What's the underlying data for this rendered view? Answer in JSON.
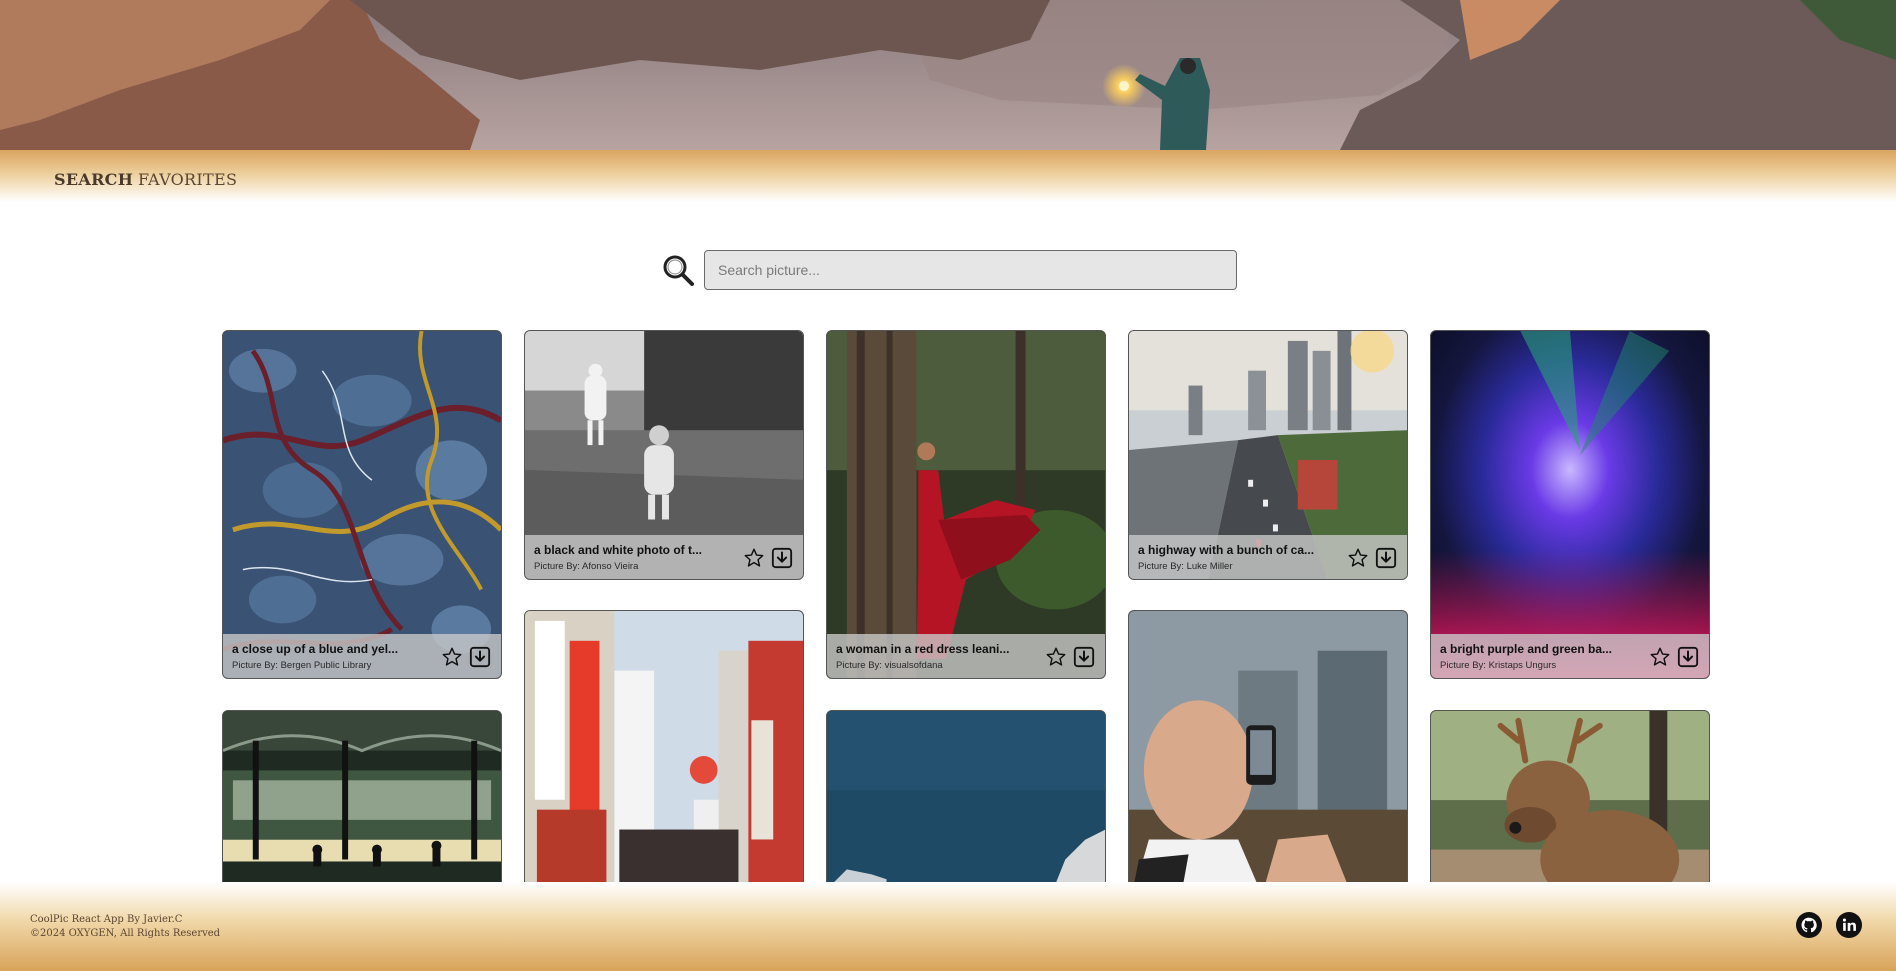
{
  "nav": {
    "items": [
      {
        "label": "SEARCH",
        "active": true
      },
      {
        "label": "FAVORITES",
        "active": false
      }
    ]
  },
  "search": {
    "value": "",
    "placeholder": "Search picture..."
  },
  "gallery": {
    "cards": [
      {
        "title": "a close up of a blue and yel...",
        "author": "Picture By: Bergen Public Library",
        "has_caption": true
      },
      {
        "title": "a black and white photo of t...",
        "author": "Picture By: Afonso Vieira",
        "has_caption": true
      },
      {
        "title": "a woman in a red dress leani...",
        "author": "Picture By: visualsofdana",
        "has_caption": true
      },
      {
        "title": "a highway with a bunch of ca...",
        "author": "Picture By: Luke Miller",
        "has_caption": true
      },
      {
        "title": "a bright purple and green ba...",
        "author": "Picture By: Kristaps Ungurs",
        "has_caption": true
      },
      {
        "has_caption": false
      },
      {
        "has_caption": false
      },
      {
        "has_caption": false
      },
      {
        "has_caption": false
      },
      {
        "has_caption": false
      }
    ]
  },
  "footer": {
    "line1": "CoolPic React App By Javier.C",
    "line2": "©2024 OXYGEN, All Rights Reserved"
  },
  "icons": [
    "search-icon",
    "star-icon",
    "download-icon",
    "github-icon",
    "linkedin-icon"
  ],
  "colors": {
    "nav_gold": "#d9a560",
    "footer_gold": "#d8a35a",
    "caption_bg": "#c8c8c8",
    "text_brown": "#5a4632"
  }
}
